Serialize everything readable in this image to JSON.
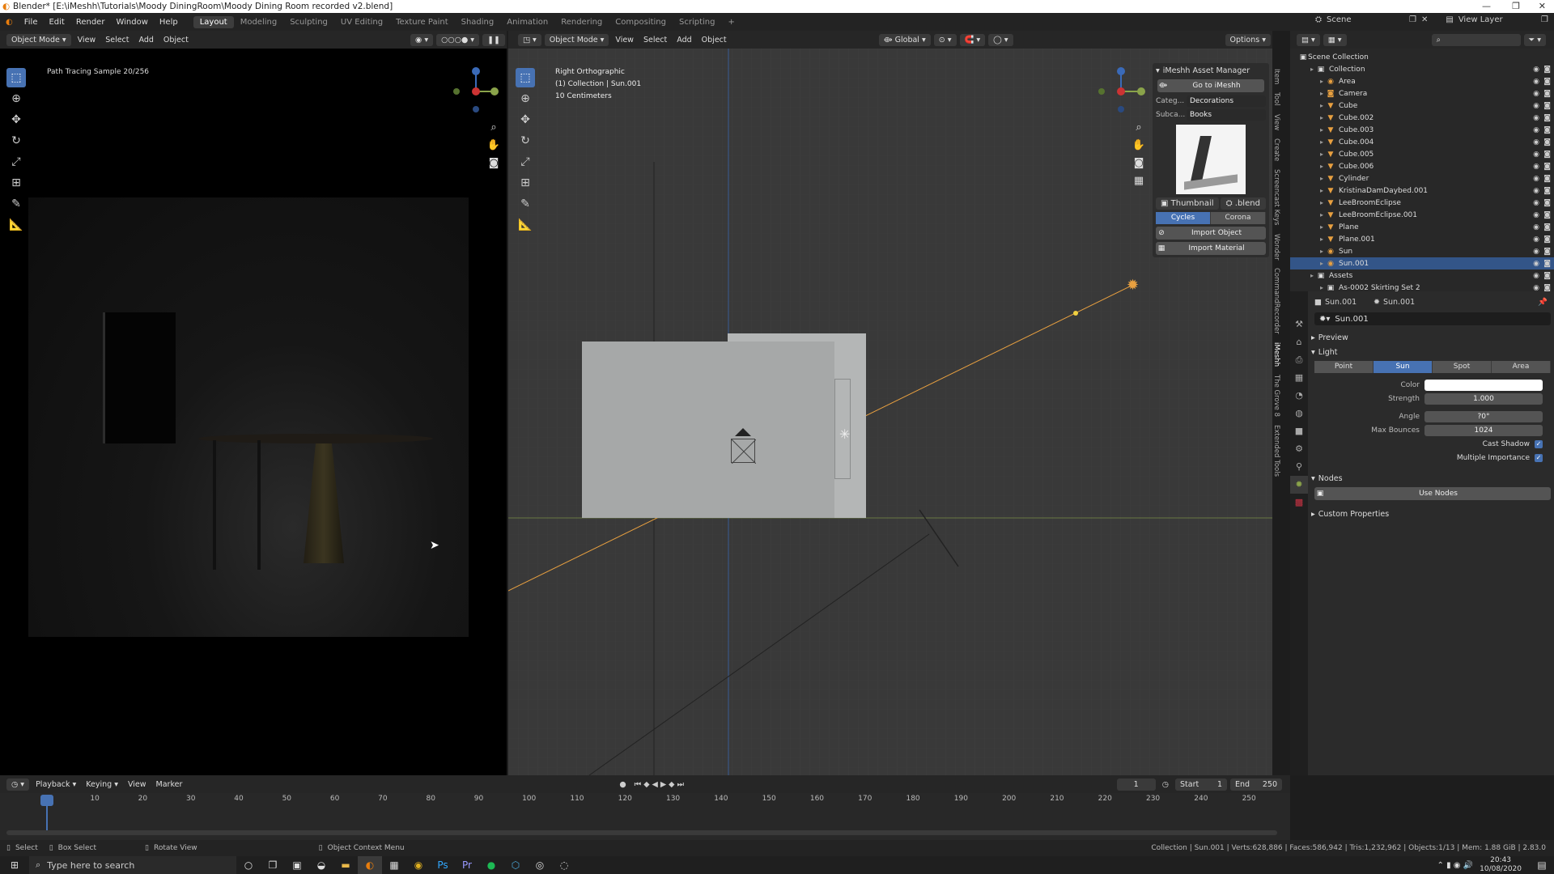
{
  "title": "Blender* [E:\\iMeshh\\Tutorials\\Moody DiningRoom\\Moody Dining Room recorded v2.blend]",
  "menus": [
    "File",
    "Edit",
    "Render",
    "Window",
    "Help"
  ],
  "workspaces": [
    "Layout",
    "Modeling",
    "Sculpting",
    "UV Editing",
    "Texture Paint",
    "Shading",
    "Animation",
    "Rendering",
    "Compositing",
    "Scripting"
  ],
  "active_workspace": "Layout",
  "scene": "Scene",
  "view_layer": "View Layer",
  "left_viewport": {
    "mode": "Object Mode",
    "menus": [
      "View",
      "Select",
      "Add",
      "Object"
    ],
    "orientation": "Global",
    "options": "Options",
    "status": "Path Tracing Sample 20/256"
  },
  "right_viewport": {
    "mode": "Object Mode",
    "menus": [
      "View",
      "Select",
      "Add",
      "Object"
    ],
    "orientation": "Global",
    "options": "Options",
    "info1": "Right Orthographic",
    "info2": "(1) Collection | Sun.001",
    "info3": "10 Centimeters"
  },
  "asset_manager": {
    "title": "iMeshh Asset Manager",
    "goto": "Go to iMeshh",
    "category_label": "Categ...",
    "category_value": "Decorations",
    "subcat_label": "Subca...",
    "subcat_value": "Books",
    "thumb_btn": "Thumbnail",
    "blend_btn": ".blend",
    "engine_a": "Cycles",
    "engine_b": "Corona",
    "import_object": "Import Object",
    "import_material": "Import Material"
  },
  "side_tabs": [
    "Item",
    "Tool",
    "View",
    "Create",
    "Screencast Keys",
    "Wonder",
    "CommandRecorder",
    "iMeshh",
    "The Grove 8",
    "Extended Tools"
  ],
  "outliner": {
    "root": "Scene Collection",
    "rows": [
      {
        "name": "Collection",
        "depth": 1,
        "icon": "collection"
      },
      {
        "name": "Area",
        "depth": 2,
        "icon": "light"
      },
      {
        "name": "Camera",
        "depth": 2,
        "icon": "camera"
      },
      {
        "name": "Cube",
        "depth": 2,
        "icon": "mesh"
      },
      {
        "name": "Cube.002",
        "depth": 2,
        "icon": "mesh"
      },
      {
        "name": "Cube.003",
        "depth": 2,
        "icon": "mesh"
      },
      {
        "name": "Cube.004",
        "depth": 2,
        "icon": "mesh"
      },
      {
        "name": "Cube.005",
        "depth": 2,
        "icon": "mesh"
      },
      {
        "name": "Cube.006",
        "depth": 2,
        "icon": "mesh"
      },
      {
        "name": "Cylinder",
        "depth": 2,
        "icon": "mesh"
      },
      {
        "name": "KristinaDamDaybed.001",
        "depth": 2,
        "icon": "mesh"
      },
      {
        "name": "LeeBroomEclipse",
        "depth": 2,
        "icon": "mesh"
      },
      {
        "name": "LeeBroomEclipse.001",
        "depth": 2,
        "icon": "mesh"
      },
      {
        "name": "Plane",
        "depth": 2,
        "icon": "mesh"
      },
      {
        "name": "Plane.001",
        "depth": 2,
        "icon": "mesh"
      },
      {
        "name": "Sun",
        "depth": 2,
        "icon": "light"
      },
      {
        "name": "Sun.001",
        "depth": 2,
        "icon": "light",
        "selected": true
      },
      {
        "name": "Assets",
        "depth": 1,
        "icon": "collection"
      },
      {
        "name": "As-0002 Skirting Set 2",
        "depth": 2,
        "icon": "collection"
      }
    ]
  },
  "properties": {
    "object": "Sun.001",
    "data": "Sun.001",
    "datablock": "Sun.001",
    "preview": "Preview",
    "light": "Light",
    "types": [
      "Point",
      "Sun",
      "Spot",
      "Area"
    ],
    "active_type": "Sun",
    "color_label": "Color",
    "strength_label": "Strength",
    "strength": "1.000",
    "angle_label": "Angle",
    "angle": "?0°",
    "max_bounces_label": "Max Bounces",
    "max_bounces": "1024",
    "cast_shadow": "Cast Shadow",
    "multiple_importance": "Multiple Importance",
    "nodes": "Nodes",
    "use_nodes": "Use Nodes",
    "custom_props": "Custom Properties"
  },
  "timeline": {
    "menus": [
      "Playback",
      "Keying",
      "View",
      "Marker"
    ],
    "current_frame": "1",
    "start_label": "Start",
    "start": "1",
    "end_label": "End",
    "end": "250",
    "ticks": [
      "1",
      "10",
      "20",
      "30",
      "40",
      "50",
      "60",
      "70",
      "80",
      "90",
      "100",
      "110",
      "120",
      "130",
      "140",
      "150",
      "160",
      "170",
      "180",
      "190",
      "200",
      "210",
      "220",
      "230",
      "240",
      "250"
    ]
  },
  "statusbar": {
    "select": "Select",
    "box_select": "Box Select",
    "rotate": "Rotate View",
    "context": "Object Context Menu",
    "stats": "Collection | Sun.001 | Verts:628,886 | Faces:586,942 | Tris:1,232,962 | Objects:1/13 | Mem: 1.88 GiB | 2.83.0"
  },
  "taskbar": {
    "search_placeholder": "Type here to search",
    "time": "20:43",
    "date": "10/08/2020"
  },
  "colors": {
    "accent": "#4772b3",
    "light_line": "#e8a040",
    "axis_y": "#8aa34a",
    "axis_z": "#3a6ab8"
  }
}
